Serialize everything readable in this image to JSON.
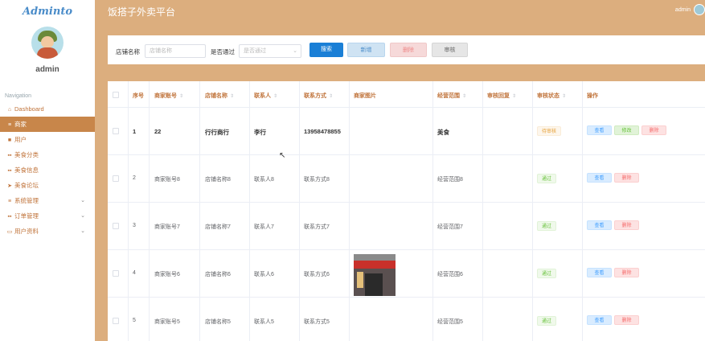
{
  "brand": "Adminto",
  "user": {
    "name": "admin"
  },
  "nav": {
    "section_title": "Navigation",
    "items": [
      {
        "label": "Dashboard",
        "icon": "home-icon"
      },
      {
        "label": "商家",
        "icon": "list-icon",
        "active": true
      },
      {
        "label": "用户",
        "icon": "user-icon"
      },
      {
        "label": "美食分类",
        "icon": "grid-icon"
      },
      {
        "label": "美食信息",
        "icon": "grid-icon"
      },
      {
        "label": "美食论坛",
        "icon": "send-icon"
      },
      {
        "label": "系统管理",
        "icon": "list-icon",
        "expandable": true
      },
      {
        "label": "订单管理",
        "icon": "grid-icon",
        "expandable": true
      },
      {
        "label": "用户资料",
        "icon": "card-icon",
        "expandable": true
      }
    ]
  },
  "header": {
    "title": "饭搭子外卖平台",
    "admin_label": "admin"
  },
  "search": {
    "shop_name_label": "店铺名称",
    "shop_name_placeholder": "店铺名称",
    "passed_label": "是否通过",
    "passed_placeholder": "是否通过",
    "search_button": "搜索",
    "add_button": "新增",
    "delete_button": "删除",
    "audit_button": "审核"
  },
  "table": {
    "columns": [
      "序号",
      "商家账号",
      "店铺名称",
      "联系人",
      "联系方式",
      "商家图片",
      "经营范围",
      "审核回复",
      "审核状态",
      "操作"
    ],
    "rows": [
      {
        "index": "1",
        "account": "22",
        "shop": "行行商行",
        "contact": "李行",
        "phone": "13958478855",
        "scope": "美食",
        "reply": "",
        "status": "待审核",
        "status_type": "pending",
        "actions": [
          "查看",
          "修改",
          "删除"
        ]
      },
      {
        "index": "2",
        "account": "商家账号8",
        "shop": "店铺名称8",
        "contact": "联系人8",
        "phone": "联系方式8",
        "scope": "经营范围8",
        "reply": "",
        "status": "通过",
        "status_type": "pass",
        "actions": [
          "查看",
          "删除"
        ]
      },
      {
        "index": "3",
        "account": "商家账号7",
        "shop": "店铺名称7",
        "contact": "联系人7",
        "phone": "联系方式7",
        "scope": "经营范围7",
        "reply": "",
        "status": "通过",
        "status_type": "pass",
        "actions": [
          "查看",
          "删除"
        ]
      },
      {
        "index": "4",
        "account": "商家账号6",
        "shop": "店铺名称6",
        "contact": "联系人6",
        "phone": "联系方式6",
        "scope": "经营范围6",
        "reply": "",
        "status": "通过",
        "status_type": "pass",
        "actions": [
          "查看",
          "删除"
        ],
        "has_image": true
      },
      {
        "index": "5",
        "account": "商家账号5",
        "shop": "店铺名称5",
        "contact": "联系人5",
        "phone": "联系方式5",
        "scope": "经营范围5",
        "reply": "",
        "status": "通过",
        "status_type": "pass",
        "actions": [
          "查看",
          "删除"
        ]
      }
    ]
  },
  "colors": {
    "accent": "#dcae7e",
    "active_nav": "#c8864a",
    "primary": "#1a7fd6"
  }
}
